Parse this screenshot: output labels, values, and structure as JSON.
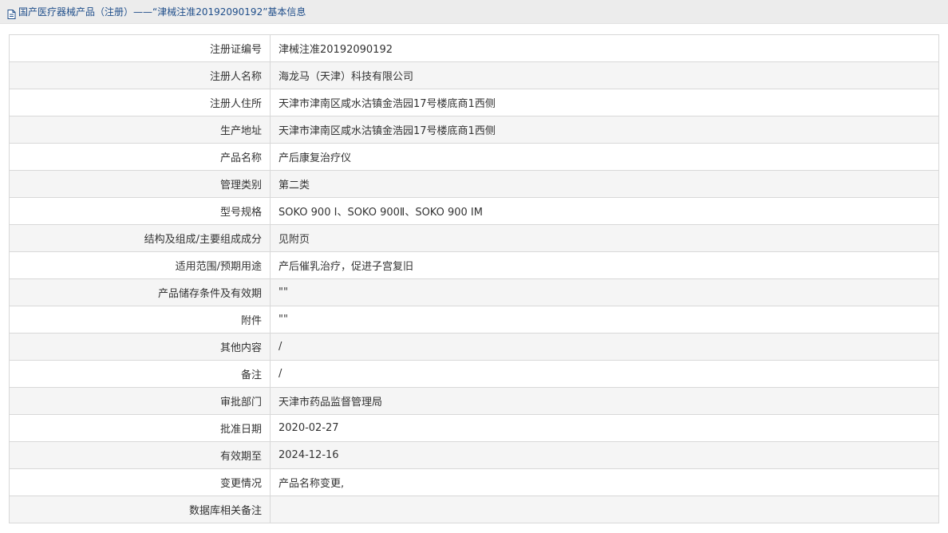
{
  "breadcrumb": {
    "icon": "document-icon",
    "text": "国产医疗器械产品（注册）——“津械注准20192090192”基本信息"
  },
  "colors": {
    "breadcrumb_text": "#1f4e8a",
    "topbar_bg": "#ececec",
    "border": "#d8d8d8",
    "row_alt_bg": "#f5f5f5"
  },
  "rows": [
    {
      "label": "注册证编号",
      "value": "津械注准20192090192"
    },
    {
      "label": "注册人名称",
      "value": "海龙马（天津）科技有限公司"
    },
    {
      "label": "注册人住所",
      "value": "天津市津南区咸水沽镇金浩园17号楼底商1西侧"
    },
    {
      "label": "生产地址",
      "value": "天津市津南区咸水沽镇金浩园17号楼底商1西侧"
    },
    {
      "label": "产品名称",
      "value": "产后康复治疗仪"
    },
    {
      "label": "管理类别",
      "value": "第二类"
    },
    {
      "label": "型号规格",
      "value": "SOKO 900 Ⅰ、SOKO 900Ⅱ、SOKO 900 ⅠM"
    },
    {
      "label": "结构及组成/主要组成成分",
      "value": "见附页"
    },
    {
      "label": "适用范围/预期用途",
      "value": "产后催乳治疗，促进子宫复旧"
    },
    {
      "label": "产品储存条件及有效期",
      "value": "\"\""
    },
    {
      "label": "附件",
      "value": "\"\""
    },
    {
      "label": "其他内容",
      "value": "/"
    },
    {
      "label": "备注",
      "value": "/"
    },
    {
      "label": "审批部门",
      "value": "天津市药品监督管理局"
    },
    {
      "label": "批准日期",
      "value": "2020-02-27"
    },
    {
      "label": "有效期至",
      "value": "2024-12-16"
    },
    {
      "label": "变更情况",
      "value": "产品名称变更,"
    },
    {
      "label": "数据库相关备注",
      "value": ""
    }
  ]
}
